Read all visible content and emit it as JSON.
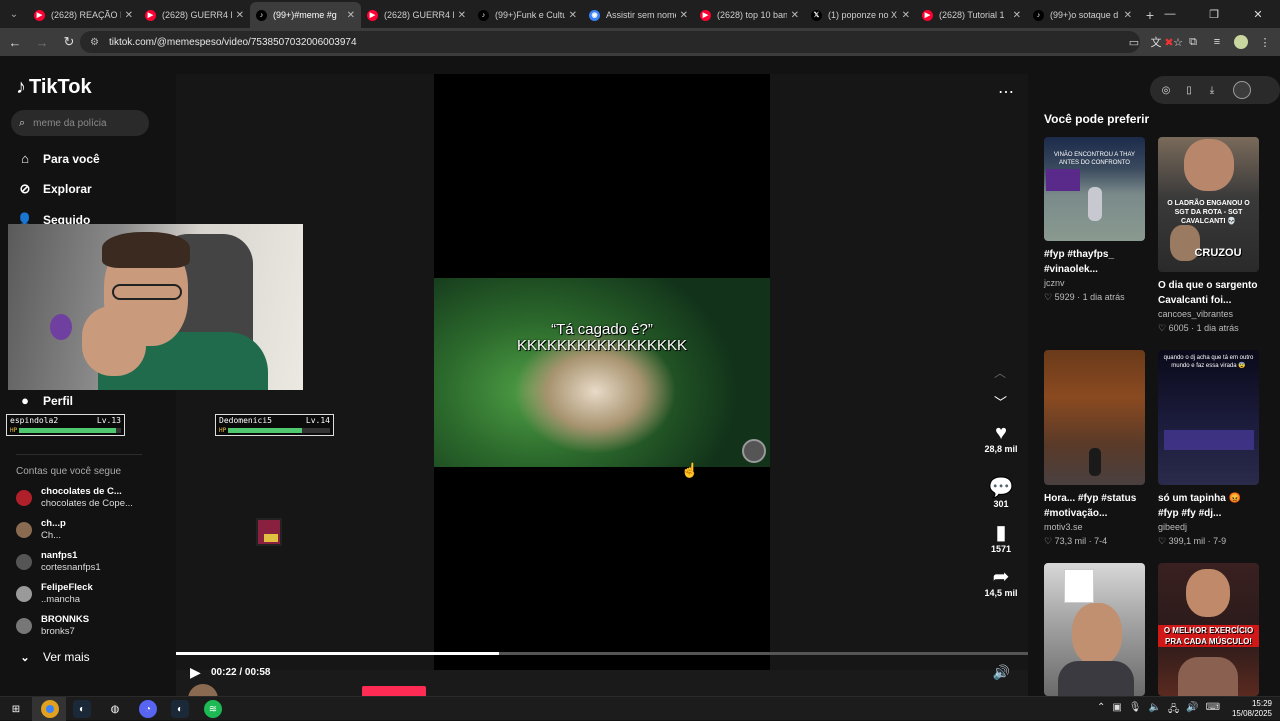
{
  "browser": {
    "tabs": [
      {
        "title": "(2628) REAÇÃO D",
        "icon": "youtube-icon",
        "color": "#ff0033",
        "active": false
      },
      {
        "title": "(2628) GUERR4 D",
        "icon": "youtube-icon",
        "color": "#ff0033",
        "active": false
      },
      {
        "title": "(99+)#meme #g",
        "icon": "tiktok-icon",
        "color": "#000000",
        "active": true
      },
      {
        "title": "(2628) GUERR4 D",
        "icon": "youtube-icon",
        "color": "#ff0033",
        "active": false
      },
      {
        "title": "(99+)Funk e Cultu",
        "icon": "tiktok-icon",
        "color": "#000000",
        "active": false
      },
      {
        "title": "Assistir sem nome",
        "icon": "globe-icon",
        "color": "#3b82f6",
        "active": false
      },
      {
        "title": "(2628) top 10 ban",
        "icon": "youtube-icon",
        "color": "#ff0033",
        "active": false
      },
      {
        "title": "(1) poponze no X",
        "icon": "x-icon",
        "color": "#000000",
        "active": false
      },
      {
        "title": "(2628) Tutorial 1",
        "icon": "youtube-icon",
        "color": "#ff0033",
        "active": false
      },
      {
        "title": "(99+)o sotaque d",
        "icon": "tiktok-icon",
        "color": "#000000",
        "active": false
      }
    ],
    "url": "tiktok.com/@memespeso/video/7538507032006003974"
  },
  "nav": {
    "logo": "TikTok",
    "search_placeholder": "meme da polícia",
    "items": [
      {
        "label": "Para você",
        "icon": "home-icon"
      },
      {
        "label": "Explorar",
        "icon": "compass-icon"
      },
      {
        "label": "Seguido",
        "icon": "user-icon"
      },
      {
        "label": "Perfil",
        "icon": "profile-icon"
      }
    ],
    "following_title": "Contas que você segue",
    "following": [
      {
        "name": "chocolates de C...",
        "handle": "chocolates de Cope...",
        "color": "#b0202a"
      },
      {
        "name": "ch...p",
        "handle": "Ch...",
        "color": "#8a6a50"
      },
      {
        "name": "nanfps1",
        "handle": "cortesnanfps1",
        "color": "#555555"
      },
      {
        "name": "FelipeFleck",
        "handle": "..mancha",
        "color": "#9a9a9a"
      },
      {
        "name": "BRONNKS",
        "handle": "bronks7",
        "color": "#777777"
      }
    ],
    "see_more": "Ver mais"
  },
  "overlay": {
    "hud_left": {
      "name": "espindola2",
      "level": "Lv.13",
      "hp": 0.95
    },
    "hud_right": {
      "name": "Dedomenici5",
      "level": "Lv.14",
      "hp": 0.72
    }
  },
  "video": {
    "caption_line1": "“Tá cagado é?”",
    "caption_line2": "KKKKKKKKKKKKKKKKK",
    "likes": "28,8 mil",
    "comments": "301",
    "saves": "1571",
    "shares": "14,5 mil",
    "current_time": "00:22",
    "duration": "00:58",
    "time_display": "00:22 / 00:58",
    "progress": 0.3793,
    "author": "memespeso"
  },
  "right": {
    "title": "Você pode preferir",
    "cards": [
      {
        "caption": "#fyp #thayfps_ #vinaolek...",
        "user": "jcznv",
        "meta": "♡ 5929 · 1 dia atrás",
        "thumb_text": "VINÃO ENCONTROU A THAY ANTES DO CONFRONTO"
      },
      {
        "caption": "O dia que o sargento Cavalcanti foi...",
        "user": "cancoes_vibrantes",
        "meta": "♡ 6005 · 1 dia atrás",
        "thumb_text": "O LADRÃO ENGANOU O SGT DA ROTA - SGT CAVALCANTI 💀",
        "thumb_text2": "CRUZOU"
      },
      {
        "caption": "Hora... #fyp #status #motivação...",
        "user": "motiv3.se",
        "meta": "♡ 73,3 mil · 7-4"
      },
      {
        "caption": "só um tapinha 😡 #fyp #fy #dj...",
        "user": "gibeedj",
        "meta": "♡ 399,1 mil · 7-9",
        "thumb_text": "quando o dj acha que tá em outro mundo e faz essa virada 😨"
      },
      {
        "caption": "",
        "user": "",
        "meta": ""
      },
      {
        "caption": "",
        "user": "",
        "meta": "",
        "thumb_text": "O MELHOR EXERCÍCIO PRA CADA MÚSCULO!"
      }
    ]
  },
  "taskbar": {
    "time": "15:29",
    "date": "15/08/2025"
  }
}
